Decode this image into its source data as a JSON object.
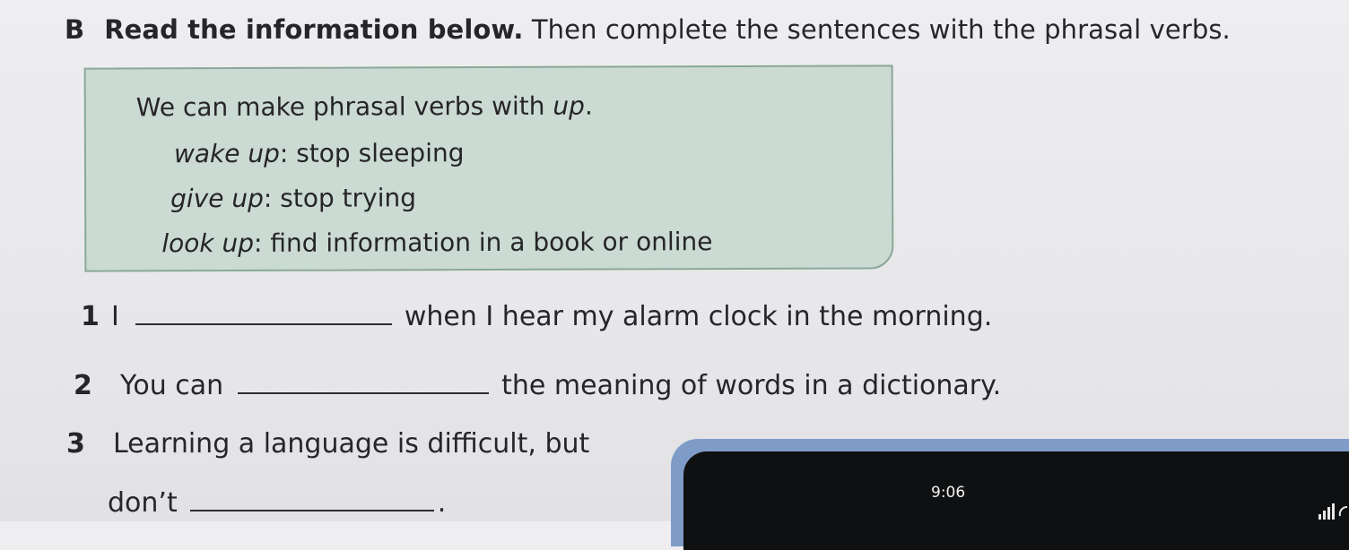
{
  "exercise": {
    "letter": "B",
    "instruction_bold": "Read the information below.",
    "instruction_rest": " Then complete the sentences with the phrasal verbs."
  },
  "info_box": {
    "intro_text": "We can make phrasal verbs with ",
    "intro_word": "up",
    "intro_end": ".",
    "definitions": [
      {
        "verb": "wake up",
        "meaning": ": stop sleeping"
      },
      {
        "verb": "give up",
        "meaning": ": stop trying"
      },
      {
        "verb": "look up",
        "meaning": ": find information in a book or online"
      }
    ]
  },
  "sentences": [
    {
      "number": "1",
      "before": "I",
      "after": "when I hear my alarm clock in the morning."
    },
    {
      "number": "2",
      "before": "You can",
      "after": "the meaning of words in a dictionary."
    },
    {
      "number": "3",
      "line1": "Learning a language is difficult, but",
      "line2_before": "don’t",
      "line2_after": "."
    }
  ],
  "phone": {
    "time": "9:06",
    "icon": "signal-bars-icon",
    "frame_color": "#7f9cc9",
    "screen_color": "#0f1012"
  },
  "colors": {
    "info_box_fill": "#cbdad2",
    "info_box_border": "#8aa898",
    "text": "#262528"
  }
}
